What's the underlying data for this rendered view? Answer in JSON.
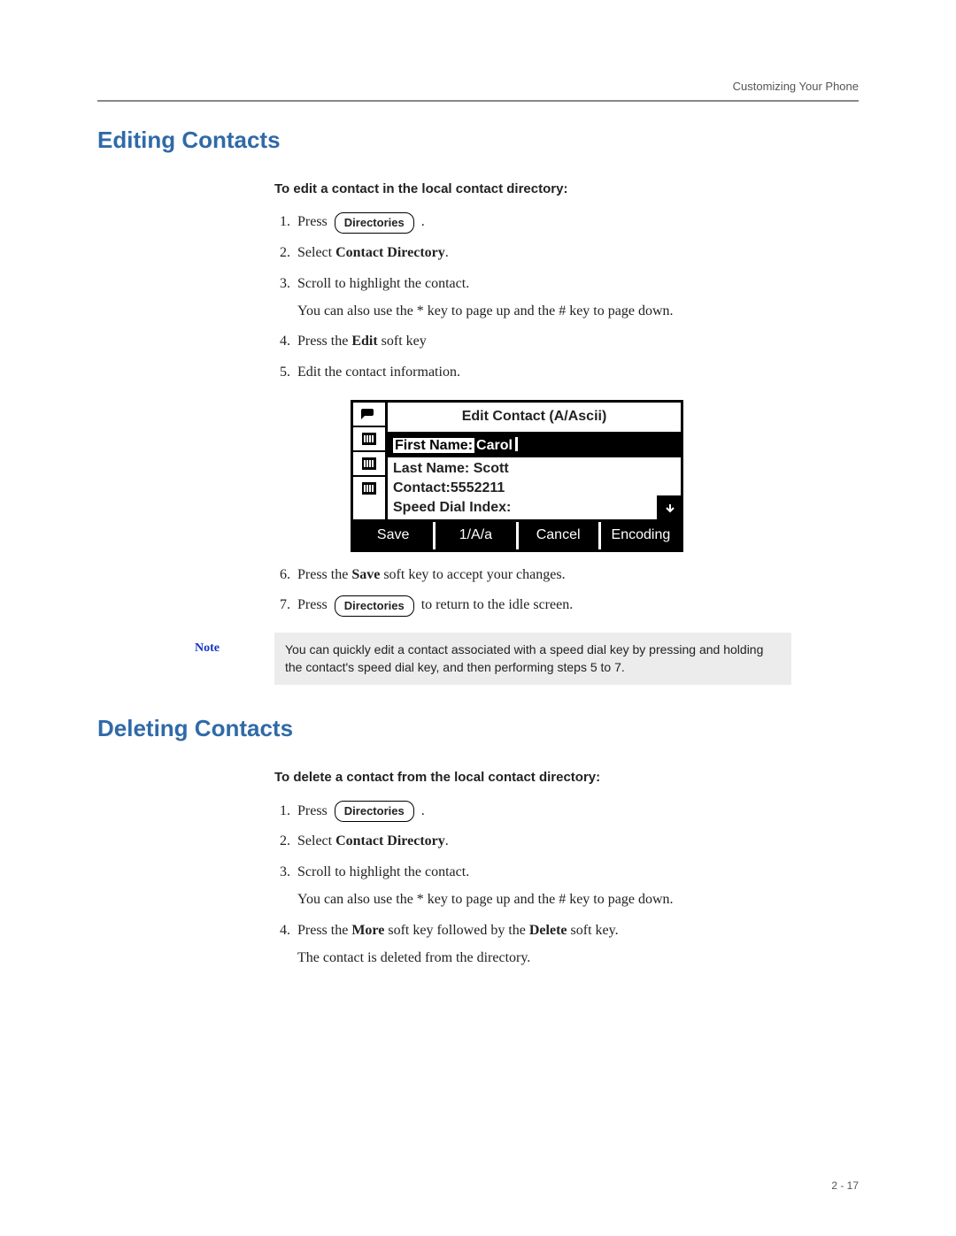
{
  "header": {
    "running_title": "Customizing Your Phone"
  },
  "section1": {
    "title": "Editing Contacts",
    "intro": "To edit a contact in the local contact directory:",
    "step1_a": "Press",
    "step1_key": "Directories",
    "step1_b": ".",
    "step2_a": "Select ",
    "step2_bold": "Contact Directory",
    "step2_b": ".",
    "step3": "Scroll to highlight the contact.",
    "step3_cont": "You can also use the * key to page up and the # key to page down.",
    "step4_a": "Press the ",
    "step4_bold": "Edit",
    "step4_b": " soft key",
    "step5": "Edit the contact information.",
    "step6_a": "Press the ",
    "step6_bold": "Save",
    "step6_b": " soft key to accept your changes.",
    "step7_a": "Press",
    "step7_key": "Directories",
    "step7_b": "to return to the idle screen."
  },
  "lcd": {
    "title": "Edit Contact (A/Ascii)",
    "line1_label": "First Name:",
    "line1_value": "Carol",
    "line2_label": "Last Name:",
    "line2_value": "Scott",
    "line3_label": "Contact:",
    "line3_value": "5552211",
    "line4_label": "Speed Dial Index:",
    "soft1": "Save",
    "soft2": "1/A/a",
    "soft3": "Cancel",
    "soft4": "Encoding"
  },
  "note": {
    "label": "Note",
    "text": "You can quickly edit a contact associated with a speed dial key by pressing and holding the contact's speed dial key, and then performing steps 5 to 7."
  },
  "section2": {
    "title": "Deleting Contacts",
    "intro": "To delete a contact from the local contact directory:",
    "step1_a": "Press",
    "step1_key": "Directories",
    "step1_b": ".",
    "step2_a": "Select ",
    "step2_bold": "Contact Directory",
    "step2_b": ".",
    "step3": "Scroll to highlight the contact.",
    "step3_cont": "You can also use the * key to page up and the # key to page down.",
    "step4_a": "Press the ",
    "step4_bold1": "More",
    "step4_mid": " soft key followed by the ",
    "step4_bold2": "Delete",
    "step4_b": " soft key.",
    "step4_cont": "The contact is deleted from the directory."
  },
  "footer": {
    "page": "2 - 17"
  }
}
